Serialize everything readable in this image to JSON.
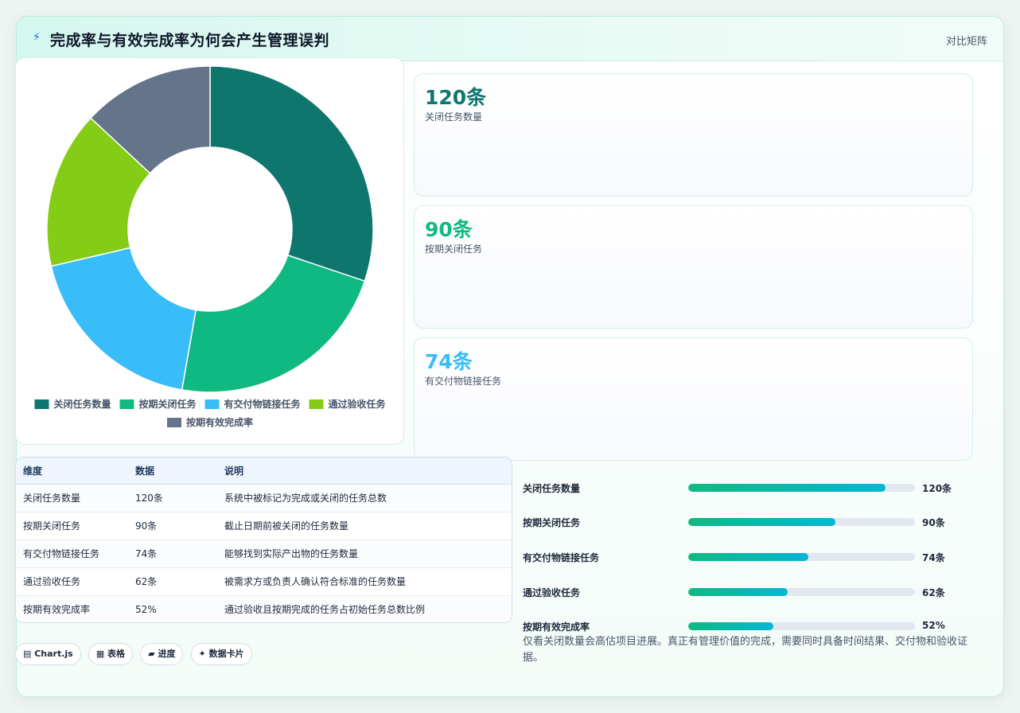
{
  "header": {
    "icon": "lightning-icon",
    "title": "完成率与有效完成率为何会产生管理误判",
    "action": "对比矩阵"
  },
  "stats": [
    {
      "value": "120条",
      "label": "关闭任务数量",
      "color": "#0f766e"
    },
    {
      "value": "90条",
      "label": "按期关闭任务",
      "color": "#10b981"
    },
    {
      "value": "74条",
      "label": "有交付物链接任务",
      "color": "#38bdf8"
    }
  ],
  "table": {
    "headers": [
      "维度",
      "数据",
      "说明"
    ],
    "rows": [
      [
        "关闭任务数量",
        "120条",
        "系统中被标记为完成或关闭的任务总数"
      ],
      [
        "按期关闭任务",
        "90条",
        "截止日期前被关闭的任务数量"
      ],
      [
        "有交付物链接任务",
        "74条",
        "能够找到实际产出物的任务数量"
      ],
      [
        "通过验收任务",
        "62条",
        "被需求方或负责人确认符合标准的任务数量"
      ],
      [
        "按期有效完成率",
        "52%",
        "通过验收且按期完成的任务占初始任务总数比例"
      ]
    ]
  },
  "progress": [
    {
      "label": "关闭任务数量",
      "value_text": "120条",
      "fraction": 0.87
    },
    {
      "label": "按期关闭任务",
      "value_text": "90条",
      "fraction": 0.65
    },
    {
      "label": "有交付物链接任务",
      "value_text": "74条",
      "fraction": 0.53
    },
    {
      "label": "通过验收任务",
      "value_text": "62条",
      "fraction": 0.44
    },
    {
      "label": "按期有效完成率",
      "value_text": "52%",
      "fraction": 0.375
    }
  ],
  "note": "仅看关闭数量会高估项目进展。真正有管理价值的完成，需要同时具备时间结果、交付物和验收证据。",
  "chips": [
    "▤ Chart.js",
    "▦ 表格",
    "▰ 进度",
    "✦ 数据卡片"
  ],
  "chart_data": {
    "type": "pie",
    "donut": true,
    "categories": [
      "关闭任务数量",
      "按期关闭任务",
      "有交付物链接任务",
      "通过验收任务",
      "按期有效完成率"
    ],
    "values": [
      120,
      90,
      74,
      62,
      52
    ],
    "colors": [
      "#0f766e",
      "#10b981",
      "#38bdf8",
      "#84cc16",
      "#64748b"
    ],
    "legend": "bottom"
  }
}
